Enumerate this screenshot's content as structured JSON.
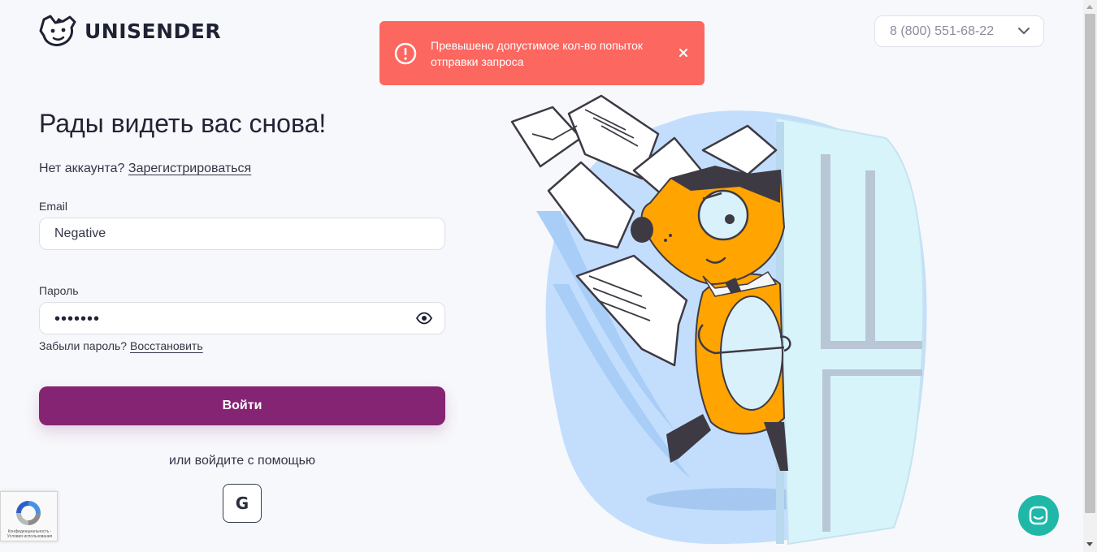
{
  "header": {
    "brand": "UNISENDER",
    "phone": "8 (800) 551-68-22"
  },
  "toast": {
    "message": "Превышено допустимое кол-во попыток отправки запроса"
  },
  "login": {
    "title": "Рады видеть вас снова!",
    "no_account_text": "Нет аккаунта?",
    "register_link": "Зарегистрироваться",
    "email_label": "Email",
    "email_value": "Negative",
    "password_label": "Пароль",
    "password_masked": "•••••••",
    "forgot_text": "Забыли пароль?",
    "restore_link": "Восстановить",
    "submit_label": "Войти",
    "alt_login_text": "или войдите с помощью",
    "google_label": "G"
  },
  "recaptcha": {
    "text": "Конфиденциальность - Условия использования"
  },
  "colors": {
    "primary": "#842473",
    "toast_bg": "#fc6760",
    "chat": "#1fb8a8",
    "fox": "#ffa400"
  },
  "icons": [
    "dog-logo-icon",
    "chevron-down-icon",
    "alert-circle-icon",
    "close-icon",
    "eye-icon",
    "google-icon",
    "recaptcha-icon",
    "chat-icon"
  ]
}
